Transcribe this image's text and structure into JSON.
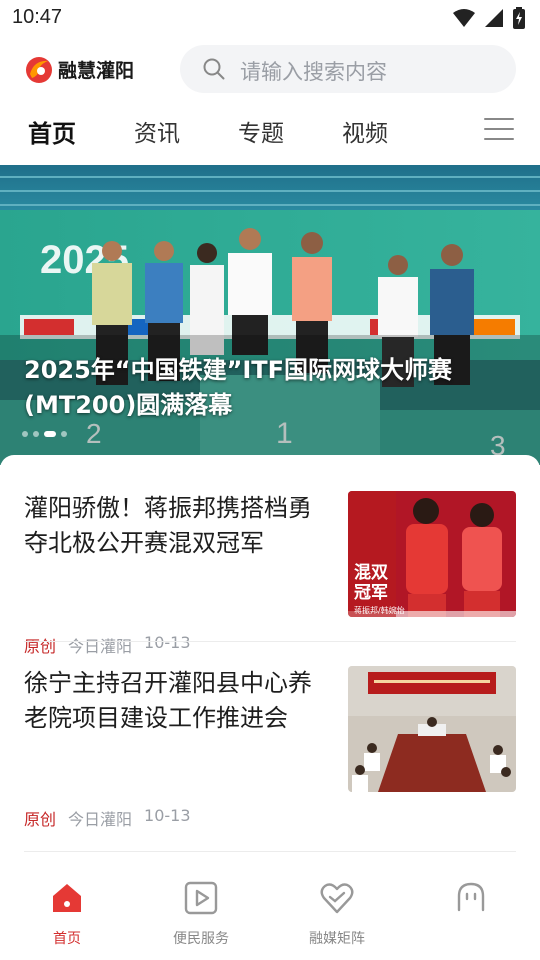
{
  "status_bar": {
    "time": "10:47"
  },
  "header": {
    "logo_text": "融慧灌阳",
    "search_placeholder": "请输入搜索内容"
  },
  "tabs": [
    {
      "label": "首页",
      "active": true
    },
    {
      "label": "资讯",
      "active": false
    },
    {
      "label": "专题",
      "active": false
    },
    {
      "label": "视频",
      "active": false
    }
  ],
  "banner": {
    "title": "2025年“中国铁建”ITF国际网球大师赛(MT200)圆满落幕",
    "dots_count": 4,
    "active_dot": 2
  },
  "news": [
    {
      "title": "灌阳骄傲！蒋振邦携搭档勇夺北极公开赛混双冠军",
      "tag": "原创",
      "source": "今日灌阳",
      "date": "10-13",
      "thumb_caption": "混双冠军",
      "thumb_sub": "蒋振邦/韩婉怡"
    },
    {
      "title": "徐宁主持召开灌阳县中心养老院项目建设工作推进会",
      "tag": "原创",
      "source": "今日灌阳",
      "date": "10-13"
    }
  ],
  "bottom_nav": [
    {
      "label": "首页",
      "icon": "home-icon",
      "active": true
    },
    {
      "label": "便民服务",
      "icon": "play-square-icon",
      "active": false
    },
    {
      "label": "融媒矩阵",
      "icon": "heart-icon",
      "active": false
    },
    {
      "label": "",
      "icon": "robot-face-icon",
      "active": false
    }
  ],
  "colors": {
    "accent": "#d32f2f",
    "search_bg": "#f3f4f6",
    "meta_gray": "#9a9ea5"
  }
}
